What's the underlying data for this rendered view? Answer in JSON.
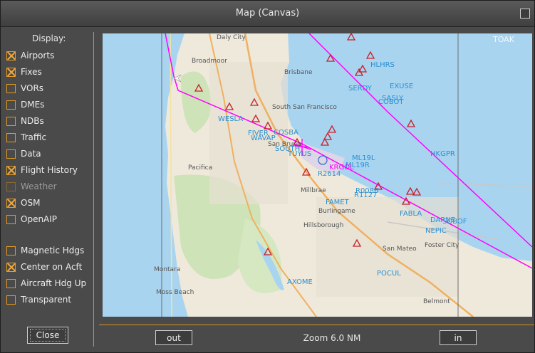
{
  "window": {
    "title": "Map (Canvas)"
  },
  "sidebar": {
    "display_label": "Display:",
    "options": [
      {
        "label": "Airports",
        "checked": true
      },
      {
        "label": "Fixes",
        "checked": true
      },
      {
        "label": "VORs",
        "checked": false
      },
      {
        "label": "DMEs",
        "checked": false
      },
      {
        "label": "NDBs",
        "checked": false
      },
      {
        "label": "Traffic",
        "checked": false
      },
      {
        "label": "Data",
        "checked": false
      },
      {
        "label": "Flight History",
        "checked": true
      },
      {
        "label": "Weather",
        "checked": false,
        "disabled": true
      },
      {
        "label": "OSM",
        "checked": true
      },
      {
        "label": "OpenAIP",
        "checked": false
      }
    ],
    "options2": [
      {
        "label": "Magnetic Hdgs",
        "checked": false
      },
      {
        "label": "Center on Acft",
        "checked": true
      },
      {
        "label": "Aircraft Hdg Up",
        "checked": false
      },
      {
        "label": "Transparent",
        "checked": false
      }
    ],
    "close_label": "Close"
  },
  "zoom": {
    "out_label": "out",
    "in_label": "in",
    "text": "Zoom 6.0 NM"
  },
  "map": {
    "place_labels": [
      "Daly City",
      "Broadmoor",
      "Brisbane",
      "South San Francisco",
      "Pacifica",
      "Millbrae",
      "Burlingame",
      "Hillsborough",
      "San Mateo",
      "Foster City",
      "Montara",
      "Moss Beach",
      "Belmont",
      "San Bruno"
    ],
    "fixes": [
      "HLHRS",
      "EXUSE",
      "SERDY",
      "SASLY",
      "COBOT",
      "WESLA",
      "FIVER",
      "WAVAP",
      "COSBA",
      "SOUTH",
      "TUYUS",
      "ML19L",
      "ML19R",
      "R2614",
      "HKGPR",
      "FAMET",
      "R0086",
      "R1127",
      "FABLA",
      "DARNE",
      "SOBOF",
      "NEPIC",
      "AXOME",
      "POCUL",
      "KRGOL"
    ],
    "watermark": "TOAK",
    "colors": {
      "water": "#a9d4f0",
      "land": "#efe9dc",
      "route": "#ff00ff",
      "fix": "#2a8fd0",
      "airport_marker": "#c8202a"
    }
  }
}
